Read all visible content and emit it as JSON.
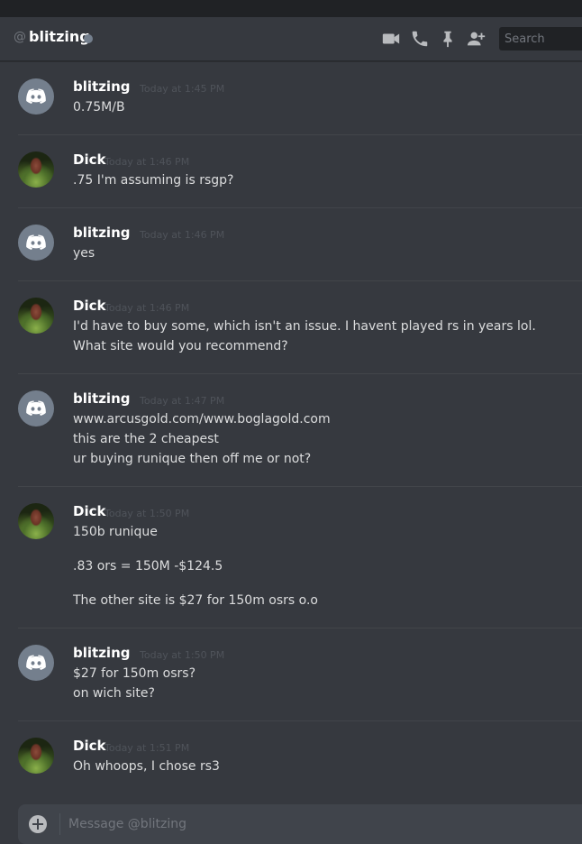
{
  "header": {
    "at_symbol": "@",
    "title": "blitzing",
    "status": "offline",
    "icons": [
      "video-call-icon",
      "voice-call-icon",
      "pin-icon",
      "add-friend-icon"
    ],
    "search_placeholder": "Search"
  },
  "messages": [
    {
      "author": "blitzing",
      "avatar": "discord-default",
      "time": "Today at 1:45 PM",
      "lines": [
        "0.75M/B"
      ]
    },
    {
      "author": "Dick",
      "avatar": "photo",
      "time": "Today at 1:46 PM",
      "lines": [
        ".75 I'm assuming is rsgp?"
      ]
    },
    {
      "author": "blitzing",
      "avatar": "discord-default",
      "time": "Today at 1:46 PM",
      "lines": [
        "yes"
      ]
    },
    {
      "author": "Dick",
      "avatar": "photo",
      "time": "Today at 1:46 PM",
      "lines": [
        "I'd have to buy some, which isn't an issue. I havent played rs in years lol.",
        "What site would you recommend?"
      ]
    },
    {
      "author": "blitzing",
      "avatar": "discord-default",
      "time": "Today at 1:47 PM",
      "lines": [
        "www.arcusgold.com/www.boglagold.com",
        "this are the 2 cheapest",
        "ur buying runique then off me or not?"
      ]
    },
    {
      "author": "Dick",
      "avatar": "photo",
      "time": "Today at 1:50 PM",
      "lines": [
        "150b runique",
        ".83 ors = 150M -$124.5",
        "The other site is $27 for 150m osrs o.o"
      ]
    },
    {
      "author": "blitzing",
      "avatar": "discord-default",
      "time": "Today at 1:50 PM",
      "lines": [
        "$27 for 150m osrs?",
        "on wich site?"
      ]
    },
    {
      "author": "Dick",
      "avatar": "photo",
      "time": "Today at 1:51 PM",
      "lines": [
        "Oh whoops, I chose rs3"
      ]
    }
  ],
  "composer": {
    "placeholder": "Message @blitzing"
  },
  "colors": {
    "background": "#36393f",
    "top_strip": "#202225",
    "divider": "#42454a",
    "username": "#ffffff",
    "message_text": "#dcddde",
    "timestamp": "#4f535a",
    "default_avatar": "#747f8d"
  }
}
